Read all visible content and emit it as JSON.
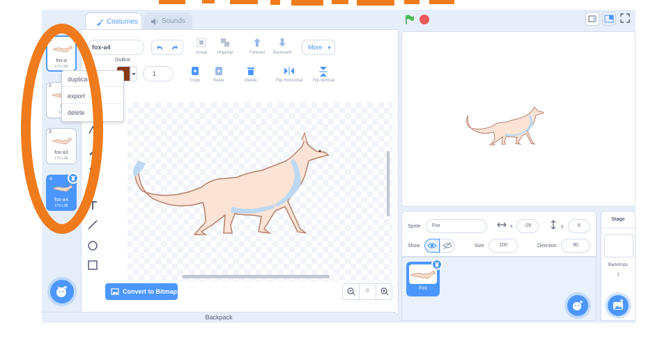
{
  "banner": {
    "text_fragment": ""
  },
  "tabs": [
    {
      "label": "Costumes"
    },
    {
      "label": "Sounds"
    }
  ],
  "costumes": [
    {
      "num": "1",
      "name": "fox-a",
      "size": "173 x 86"
    },
    {
      "num": "2",
      "name": "f",
      "size": "173"
    },
    {
      "num": "3",
      "name": "fox-a3",
      "size": "173 x 86"
    },
    {
      "num": "4",
      "name": "fox-a4",
      "size": "173 x 86"
    }
  ],
  "context_menu": {
    "items": [
      "duplica",
      "export",
      "delete"
    ]
  },
  "editor": {
    "costume_name": "fox-a4",
    "group": "Group",
    "ungroup": "Ungroup",
    "forward": "Forward",
    "backward": "Backward",
    "more": "More",
    "outline_label": "Outline",
    "stroke_width": "1",
    "copy": "Copy",
    "paste": "Paste",
    "delete": "Delete",
    "flip_h": "Flip Horizontal",
    "flip_v": "Flip Vertical",
    "convert": "Convert to Bitmap",
    "zoom_reset": "="
  },
  "backpack": {
    "label": "Backpack"
  },
  "sprite_info": {
    "sprite_label": "Sprite",
    "sprite_name": "Fox",
    "x_label": "x",
    "x_value": "-29",
    "y_label": "y",
    "y_value": "6",
    "show_label": "Show",
    "size_label": "Size",
    "size_value": "100",
    "direction_label": "Direction",
    "direction_value": "90"
  },
  "sprites": [
    {
      "name": "Fox"
    }
  ],
  "stage_panel": {
    "title": "Stage",
    "backdrops_label": "Backdrops",
    "backdrops_count": "1"
  },
  "colors": {
    "accent": "#4c97ff",
    "annotation": "#f07b1c",
    "stop": "#ec5959",
    "flag": "#4cbf56"
  }
}
